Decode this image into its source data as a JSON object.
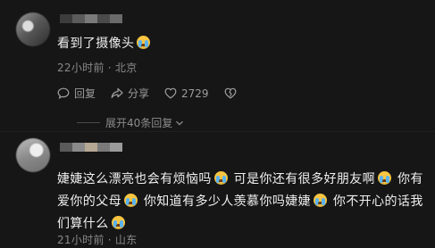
{
  "comment1": {
    "text": "看到了摄像头",
    "time": "22小时前",
    "separator": "·",
    "location": "北京",
    "actions": {
      "reply": "回复",
      "share": "分享",
      "likes": "2729"
    },
    "expand_replies": "展开40条回复"
  },
  "comment2": {
    "segments": [
      "婕婕这么漂亮也会有烦恼吗",
      "可是你还有很多好朋友啊",
      "你有爱你的父母",
      "你知道有多少人羡慕你吗婕婕",
      "你不开心的话我们算什么"
    ],
    "time": "21小时前",
    "separator": "·",
    "location": "山东"
  },
  "icons": {
    "emoji": "loudly-crying-emoji",
    "reply": "chat-bubble-icon",
    "share": "share-arrow-icon",
    "like": "heart-icon",
    "dislike": "broken-heart-icon",
    "expand": "chevron-down-icon"
  },
  "colors": {
    "background": "#161616",
    "text": "#efefef",
    "muted": "#8a8a8a",
    "emoji": "#f7c542"
  }
}
